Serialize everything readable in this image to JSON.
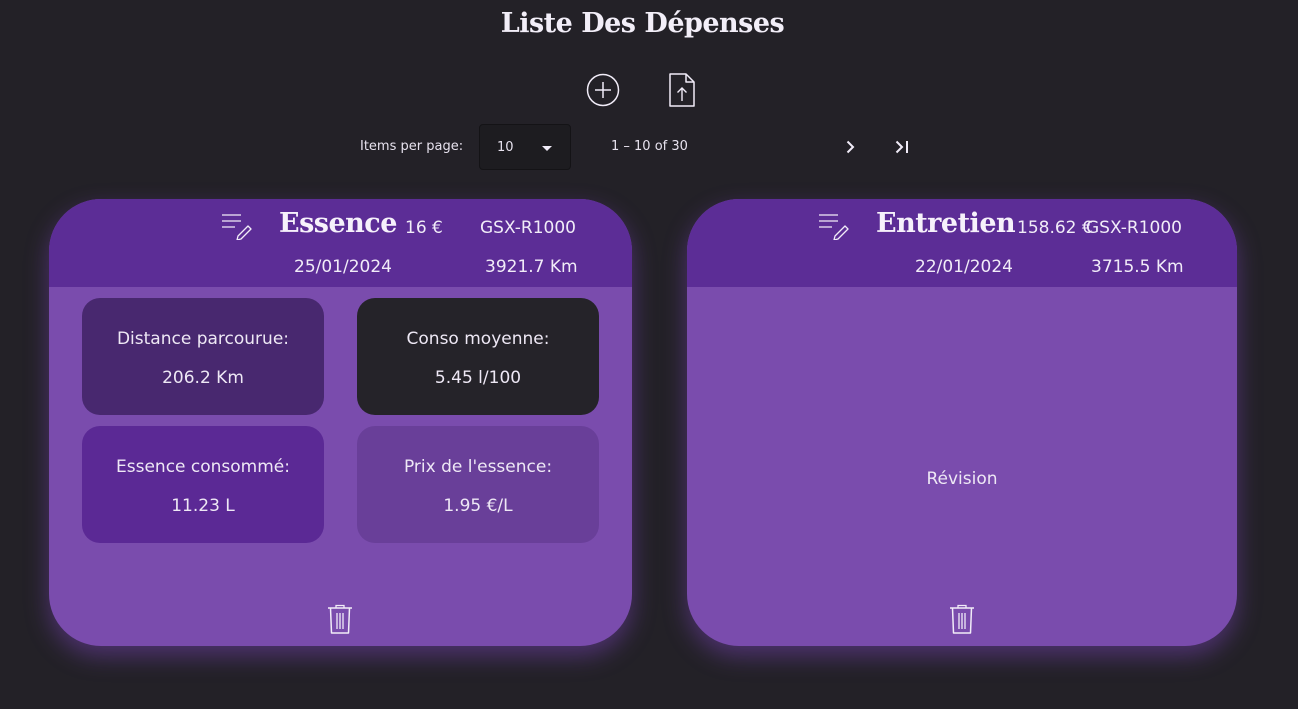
{
  "header": {
    "title": "Liste Des Dépenses",
    "add_icon": "plus-circle-icon",
    "upload_icon": "file-upload-icon"
  },
  "paginator": {
    "items_per_page_label": "Items per page:",
    "page_size": "10",
    "range_label": "1 – 10 of 30",
    "next_icon": "chevron-right-icon",
    "last_icon": "last-page-icon"
  },
  "cards": [
    {
      "type": "Essence",
      "amount": "16 €",
      "vehicle": "GSX-R1000",
      "date": "25/01/2024",
      "mileage": "3921.7 Km",
      "stats": [
        {
          "label": "Distance parcourue:",
          "value": "206.2 Km",
          "color": "#48286f"
        },
        {
          "label": "Conso moyenne:",
          "value": "5.45 l/100",
          "color": "#252329"
        },
        {
          "label": "Essence consommé:",
          "value": "11.23 L",
          "color": "#5b2995"
        },
        {
          "label": "Prix de l'essence:",
          "value": "1.95 €/L",
          "color": "#693f99"
        }
      ],
      "edit_icon": "edit-list-icon",
      "delete_icon": "trash-icon"
    },
    {
      "type": "Entretien",
      "amount": "158.62 €",
      "vehicle": "GSX-R1000",
      "date": "22/01/2024",
      "mileage": "3715.5 Km",
      "description": "Révision",
      "edit_icon": "edit-list-icon",
      "delete_icon": "trash-icon"
    }
  ],
  "colors": {
    "background": "#232127",
    "card_body": "#7a4cad",
    "card_header": "#5c2d96"
  }
}
